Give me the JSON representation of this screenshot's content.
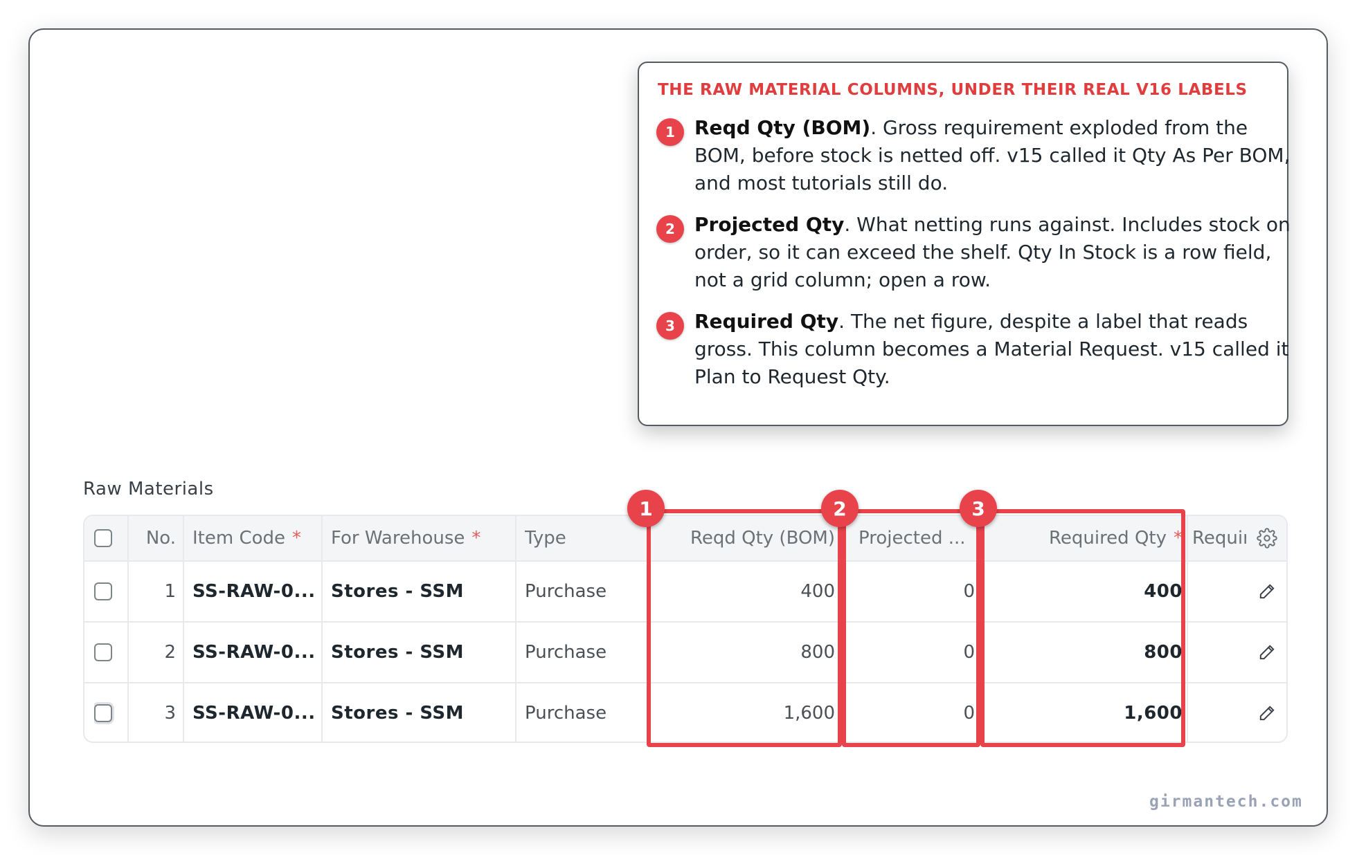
{
  "callout": {
    "title": "THE RAW MATERIAL COLUMNS, UNDER THEIR REAL V16 LABELS",
    "notes": [
      {
        "num": "1",
        "term": "Reqd Qty (BOM)",
        "text": ". Gross requirement exploded from the BOM, before stock is netted off. v15 called it Qty As Per BOM, and most tutorials still do."
      },
      {
        "num": "2",
        "term": "Projected Qty",
        "text": ". What netting runs against. Includes stock on order, so it can exceed the shelf. Qty In Stock is a row field, not a grid column; open a row."
      },
      {
        "num": "3",
        "term": "Required Qty",
        "text": ". The net figure, despite a label that reads gross. This column becomes a Material Request. v15 called it Plan to Request Qty."
      }
    ]
  },
  "section": {
    "label": "Raw Materials"
  },
  "grid": {
    "headers": {
      "no": "No.",
      "item_code": "Item Code",
      "warehouse": "For Warehouse",
      "type": "Type",
      "reqd_qty_bom": "Reqd Qty (BOM)",
      "projected": "Projected ...",
      "required_qty": "Required Qty",
      "requir": "Requir",
      "required_marker": "*"
    },
    "rows": [
      {
        "no": "1",
        "item_code": "SS-RAW-0...",
        "warehouse": "Stores - SSM",
        "type": "Purchase",
        "reqd_qty_bom": "400",
        "projected": "0",
        "required_qty": "400"
      },
      {
        "no": "2",
        "item_code": "SS-RAW-0...",
        "warehouse": "Stores - SSM",
        "type": "Purchase",
        "reqd_qty_bom": "800",
        "projected": "0",
        "required_qty": "800"
      },
      {
        "no": "3",
        "item_code": "SS-RAW-0...",
        "warehouse": "Stores - SSM",
        "type": "Purchase",
        "reqd_qty_bom": "1,600",
        "projected": "0",
        "required_qty": "1,600"
      }
    ]
  },
  "highlights": {
    "badges": [
      "1",
      "2",
      "3"
    ],
    "color": "#e8434b"
  },
  "icons": {
    "settings": "gear-icon",
    "edit": "pencil-icon"
  },
  "watermark": "girmantech.com"
}
